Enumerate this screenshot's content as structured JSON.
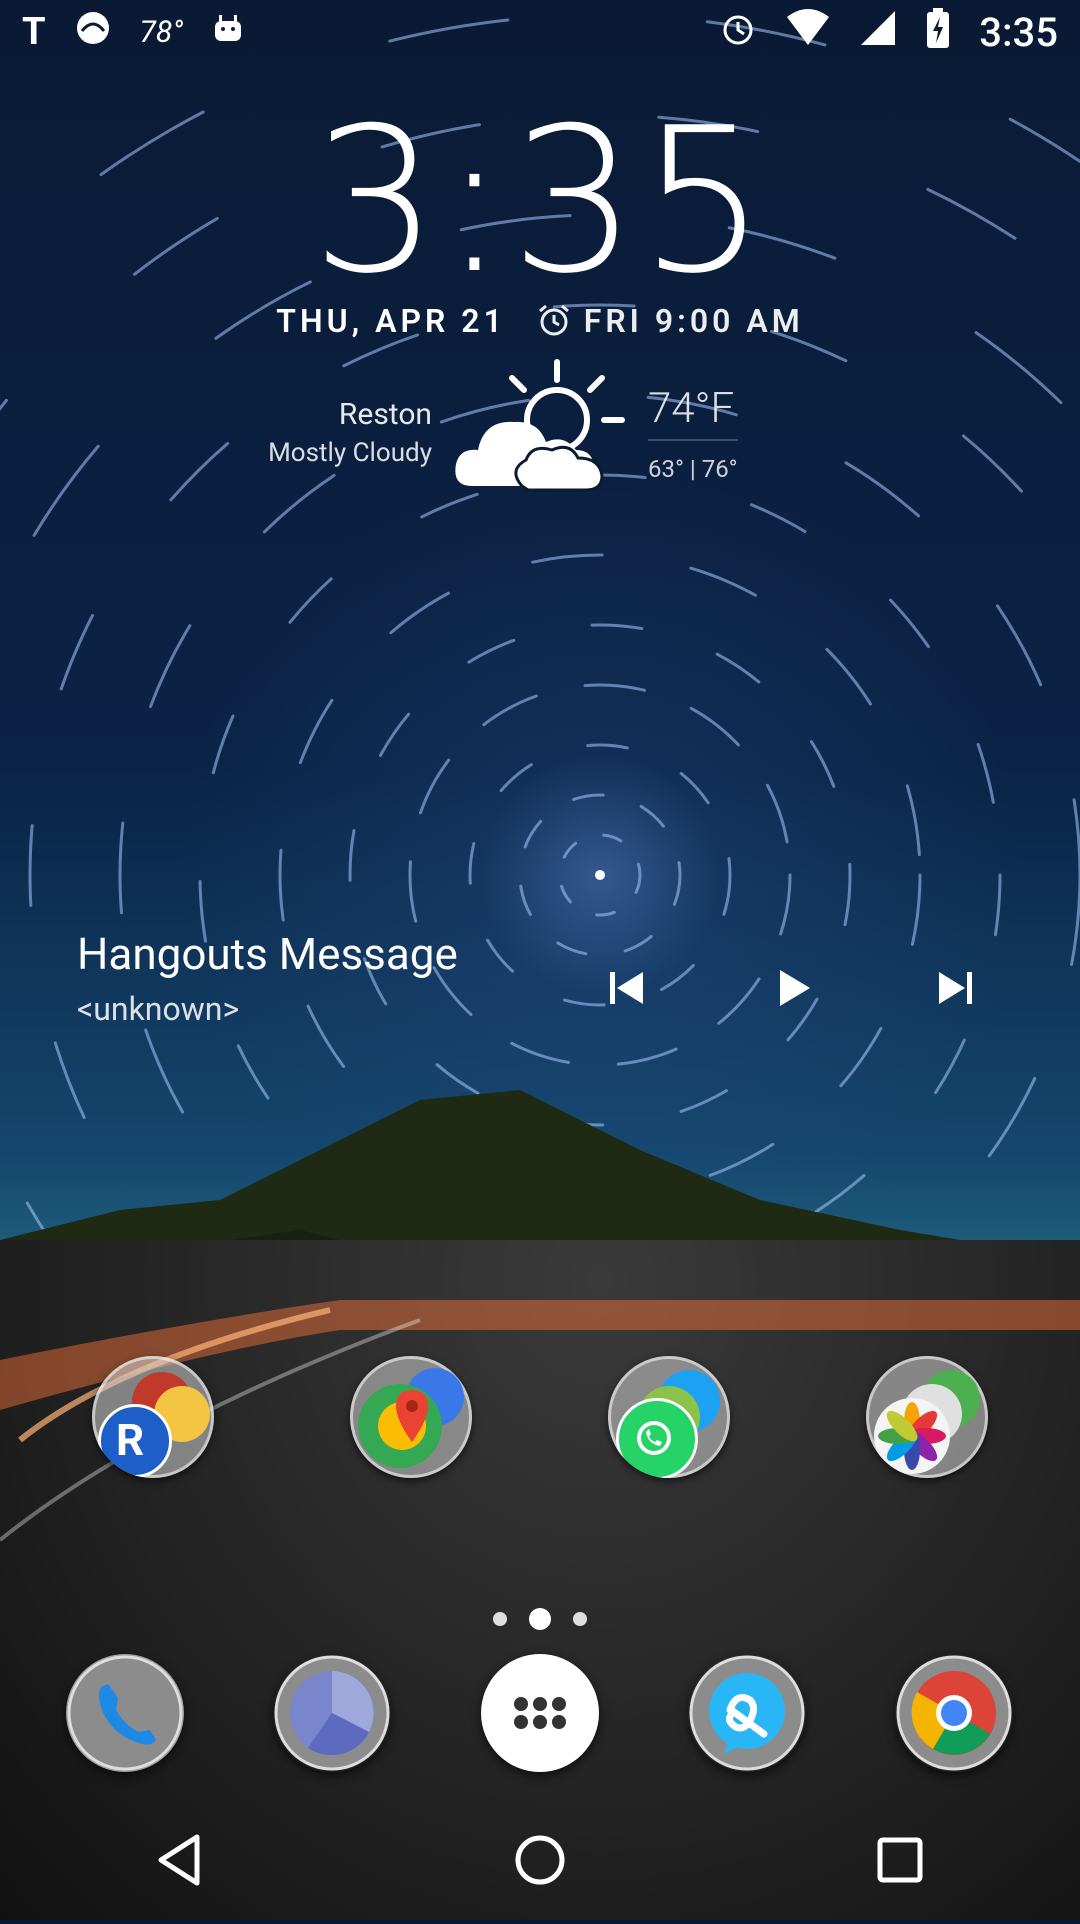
{
  "status_bar": {
    "left_icons": [
      "t-mobile-icon",
      "sync-ball-icon",
      "temperature-badge",
      "android-icon"
    ],
    "temperature": "78°",
    "right_icons": [
      "alarm-icon",
      "wifi-icon",
      "signal-icon",
      "battery-charging-icon"
    ],
    "time": "3:35"
  },
  "clock_widget": {
    "time": "3:35",
    "date": "THU, APR 21",
    "next_alarm": "FRI 9:00 AM"
  },
  "weather": {
    "city": "Reston",
    "condition": "Mostly Cloudy",
    "temperature": "74°F",
    "range": "63° | 76°",
    "icon": "partly-cloudy-icon"
  },
  "media": {
    "title": "Hangouts Message",
    "subtitle": "<unknown>",
    "controls": [
      "previous-icon",
      "play-icon",
      "next-icon"
    ]
  },
  "folders": [
    {
      "name": "folder-1"
    },
    {
      "name": "folder-2"
    },
    {
      "name": "folder-3"
    },
    {
      "name": "folder-4"
    }
  ],
  "page_indicator": {
    "pages": 3,
    "active": 2
  },
  "dock": [
    {
      "name": "phone-app-icon"
    },
    {
      "name": "clock-app-icon"
    },
    {
      "name": "app-drawer-icon"
    },
    {
      "name": "messaging-app-icon"
    },
    {
      "name": "chrome-app-icon"
    }
  ],
  "navigation": [
    "back-icon",
    "home-icon",
    "recents-icon"
  ]
}
